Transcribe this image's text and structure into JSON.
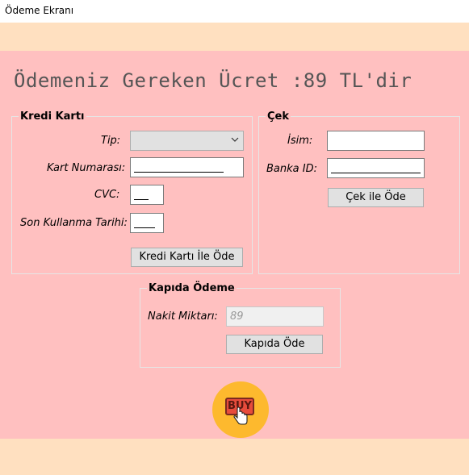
{
  "window": {
    "title": "Ödeme Ekranı"
  },
  "heading": "Ödemeniz Gereken Ücret :89 TL'dir",
  "credit_card": {
    "title": "Kredi Kartı",
    "type_label": "Tip:",
    "type_value": "",
    "card_number_label": "Kart Numarası:",
    "cvc_label": "CVC:",
    "expiry_label": "Son Kullanma Tarihi:",
    "pay_button": "Kredi Kartı İle Öde"
  },
  "check": {
    "title": "Çek",
    "name_label": "İsim:",
    "name_value": "",
    "bank_id_label": "Banka ID:",
    "pay_button": "Çek ile Öde"
  },
  "cash_on_delivery": {
    "title": "Kapıda Ödeme",
    "amount_label": "Nakit Miktarı:",
    "amount_value": "89",
    "pay_button": "Kapıda Öde"
  },
  "buy_icon": {
    "label": "BUY",
    "icon": "buy-cursor-icon"
  },
  "colors": {
    "main_background": "#ffc0c0",
    "band_background": "#ffe0c0",
    "buy_circle": "#fdb92e",
    "buy_tag": "#e74c3c"
  }
}
